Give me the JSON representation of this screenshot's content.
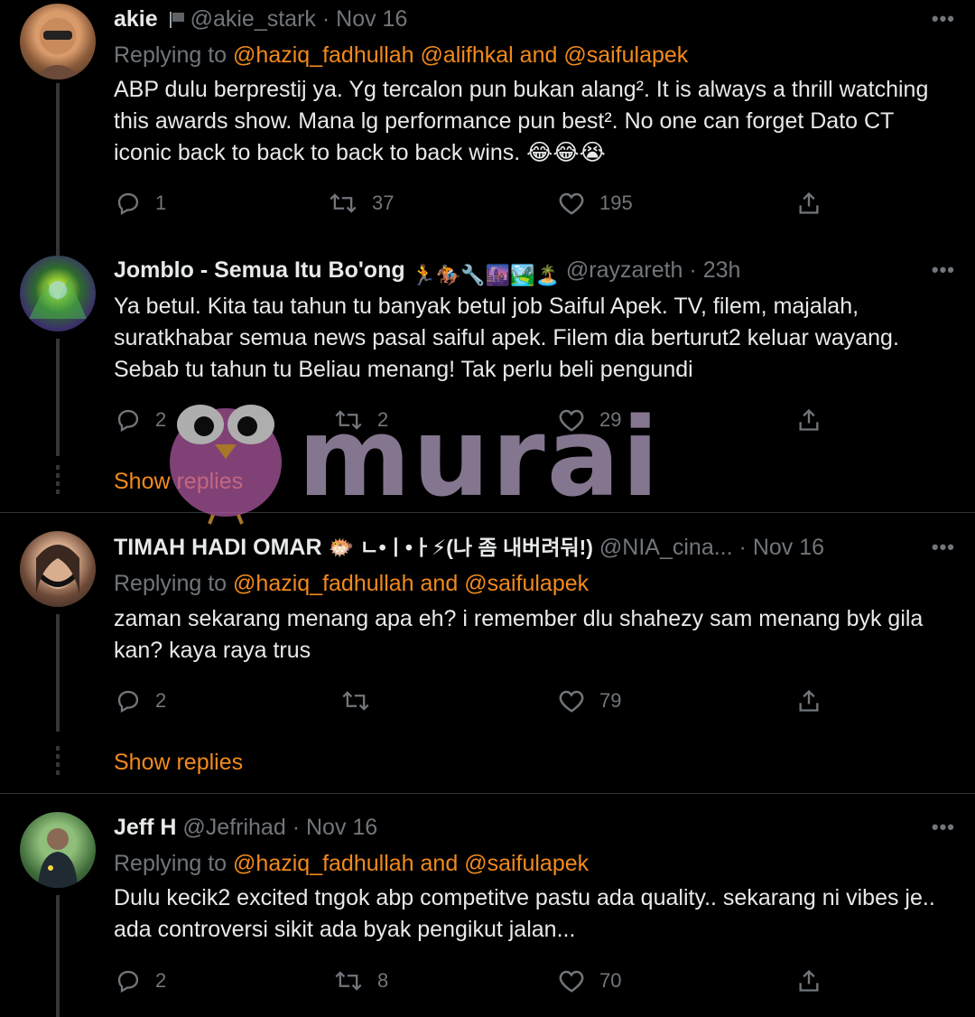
{
  "colors": {
    "background": "#000000",
    "text": "#e7e9ea",
    "muted": "#71767b",
    "mention": "#f28a1c",
    "divider": "#2f3336",
    "watermark": "#b8a4c6"
  },
  "tweets": [
    {
      "name": "akie",
      "handle": "@akie_stark",
      "dot": "·",
      "time": "Nov 16",
      "reply_label": "Replying to",
      "mentions": [
        "@haziq_fadhullah",
        "@alifhkal",
        "and",
        "@saifulapek"
      ],
      "text": "ABP dulu berprestij ya. Yg tercalon pun bukan alang². It is always a thrill watching this awards show. Mana lg performance pun best². No one can forget Dato CT iconic back to back to back to back wins. 😂😂😭",
      "replies": "1",
      "retweets": "37",
      "likes": "195"
    },
    {
      "name": "Jomblo - Semua Itu Bo'ong",
      "name_emoji": "🏃🏇🔧🌆🏞️🏝️",
      "handle": "@rayzareth",
      "dot": "·",
      "time": "23h",
      "text": "Ya betul. Kita tau tahun tu banyak betul job Saiful Apek. TV, filem, majalah, suratkhabar semua news  pasal saiful apek. Filem dia berturut2 keluar wayang. Sebab tu tahun tu Beliau menang! Tak perlu beli pengundi",
      "replies": "2",
      "retweets": "2",
      "likes": "29",
      "show_replies": "Show replies"
    },
    {
      "name": "TIMAH HADI OMAR",
      "name_emoji": "🐡 ㄴ•ㅣ•ㅏ⚡(나 좀 내버려둬!)",
      "handle": "@NIA_cina...",
      "dot": "·",
      "time": "Nov 16",
      "reply_label": "Replying to",
      "mentions": [
        "@haziq_fadhullah",
        "and",
        "@saifulapek"
      ],
      "text": "zaman sekarang menang apa eh? i remember dlu shahezy sam menang byk gila kan? kaya raya trus",
      "replies": "2",
      "retweets": "",
      "likes": "79",
      "show_replies": "Show replies"
    },
    {
      "name": "Jeff H",
      "handle": "@Jefrihad",
      "dot": "·",
      "time": "Nov 16",
      "reply_label": "Replying to",
      "mentions": [
        "@haziq_fadhullah",
        "and",
        "@saifulapek"
      ],
      "text": "Dulu kecik2 excited tngok abp competitve pastu ada quality.. sekarang ni vibes je.. ada controversi sikit ada byak pengikut jalan...",
      "replies": "2",
      "retweets": "8",
      "likes": "70"
    }
  ],
  "watermark": {
    "text": "murai"
  }
}
